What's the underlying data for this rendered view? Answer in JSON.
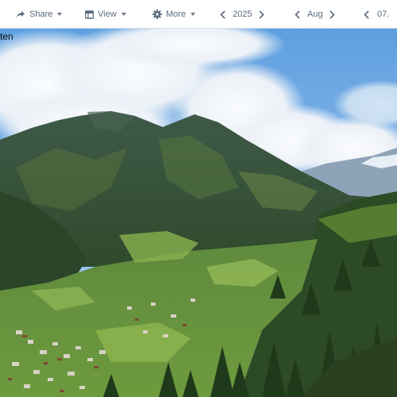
{
  "toolbar": {
    "share_label": "Share",
    "view_label": "View",
    "more_label": "More",
    "year_value": "2025",
    "month_value": "Aug",
    "day_value": "07."
  },
  "photo": {
    "caption": "ten",
    "description_icon": "landscape-photo"
  },
  "colors": {
    "toolbar_text": "#5a6a7e",
    "toolbar_bg": "#ffffff",
    "sky": "#7fb2e8"
  }
}
